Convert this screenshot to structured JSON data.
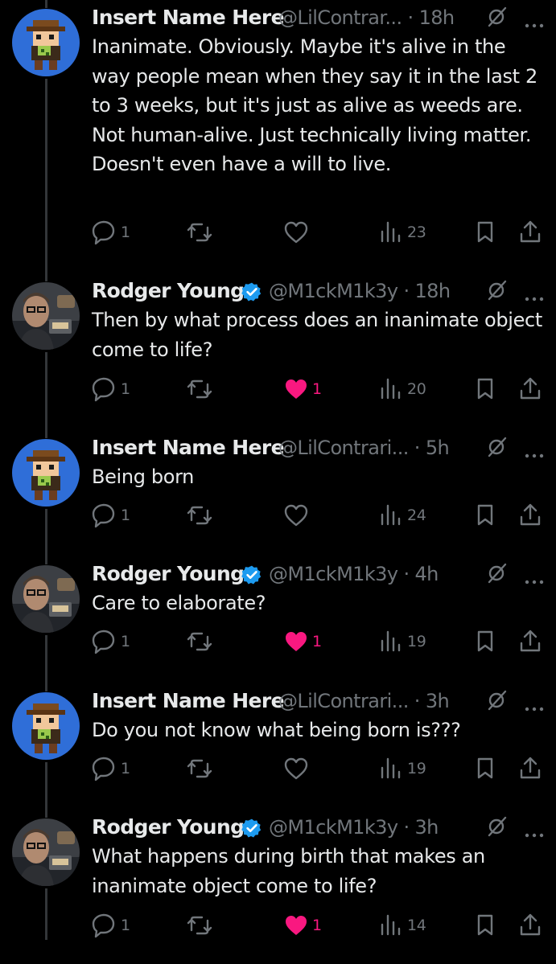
{
  "colors": {
    "background": "#000000",
    "text": "#e7e9ea",
    "secondary": "#71767b",
    "verified": "#1d9bf0",
    "like_active": "#f91880"
  },
  "tweets": [
    {
      "name": "Insert Name Here",
      "handle_line": "@LilContrar... · 18h",
      "verified": false,
      "avatar": "pixel-cowboy-avatar",
      "text": "Inanimate. Obviously. Maybe it's alive in the way people mean when they say it in the last 2 to 3 weeks, but it's just as alive as weeds are. Not human-alive. Just technically living matter. Doesn't even have a will to live.",
      "replies": "1",
      "retweets": "",
      "likes": "",
      "liked": false,
      "views": "23"
    },
    {
      "name": "Rodger Young",
      "handle_line": "@M1ckM1k3y · 18h",
      "verified": true,
      "avatar": "man-with-glasses-avatar",
      "text": "Then by what process does an inanimate object come to life?",
      "replies": "1",
      "retweets": "",
      "likes": "1",
      "liked": true,
      "views": "20"
    },
    {
      "name": "Insert Name Here",
      "handle_line": "@LilContrari... · 5h",
      "verified": false,
      "avatar": "pixel-cowboy-avatar",
      "text": "Being born",
      "replies": "1",
      "retweets": "",
      "likes": "",
      "liked": false,
      "views": "24"
    },
    {
      "name": "Rodger Young",
      "handle_line": "@M1ckM1k3y · 4h",
      "verified": true,
      "avatar": "man-with-glasses-avatar",
      "text": "Care to elaborate?",
      "replies": "1",
      "retweets": "",
      "likes": "1",
      "liked": true,
      "views": "19"
    },
    {
      "name": "Insert Name Here",
      "handle_line": "@LilContrari... · 3h",
      "verified": false,
      "avatar": "pixel-cowboy-avatar",
      "text": "Do you not know what being born is???",
      "replies": "1",
      "retweets": "",
      "likes": "",
      "liked": false,
      "views": "19"
    },
    {
      "name": "Rodger Young",
      "handle_line": "@M1ckM1k3y · 3h",
      "verified": true,
      "avatar": "man-with-glasses-avatar",
      "text": "What happens during birth that makes an inanimate object come to life?",
      "replies": "1",
      "retweets": "",
      "likes": "1",
      "liked": true,
      "views": "14"
    }
  ]
}
